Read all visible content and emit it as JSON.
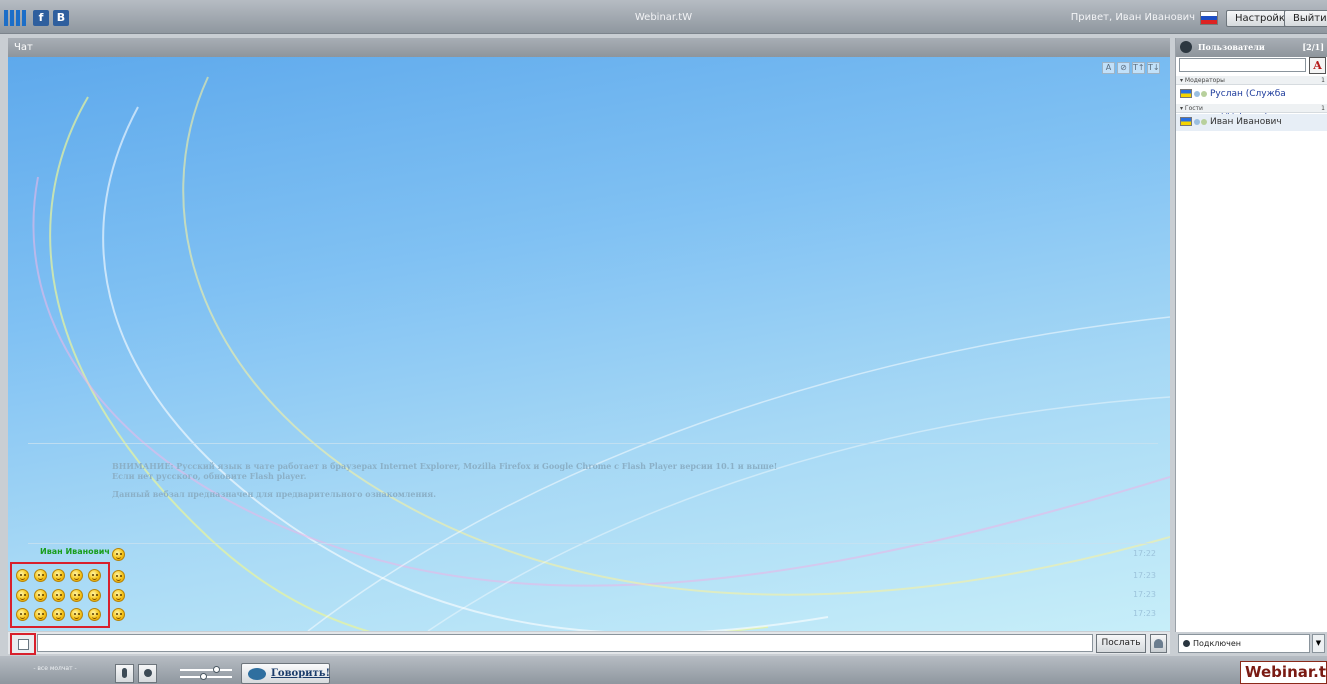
{
  "header": {
    "title": "Webinar.tW",
    "greeting": "Привет, Иван Иванович",
    "social": [
      {
        "label": "f"
      },
      {
        "label": "B"
      }
    ],
    "settings_label": "Настройки",
    "logout_label": "Выйти"
  },
  "chat": {
    "title": "Чат",
    "tools": [
      "A",
      "⊘",
      "T↑",
      "T↓"
    ],
    "notice": {
      "line1": "ВНИМАНИЕ: Русский язык в чате работает в браузерах Internet Explorer, Mozilla Firefox и Google Chrome с Flash Player версии 10.1 и выше!",
      "line2": "Если нет русского, обновите Flash player.",
      "line3": "Данный вебзал предназначен для предварительного ознакомления."
    },
    "messages": [
      {
        "author": "Иван Иванович",
        "time": "17:22"
      },
      {
        "author": "",
        "time": "17:23"
      },
      {
        "author": "",
        "time": "17:23"
      },
      {
        "author": "",
        "time": "17:23"
      }
    ],
    "send_label": "Послать",
    "input_value": ""
  },
  "users": {
    "title": "Пользователи",
    "count": "[2/1]",
    "font_button": "A",
    "groups": [
      {
        "label": "▾ Модераторы",
        "count": "1",
        "users": [
          "Руслан (Служба поддержки)"
        ]
      },
      {
        "label": "▾ Гости",
        "count": "1",
        "users": [
          "Иван Иванович"
        ]
      }
    ],
    "status": "Подключен"
  },
  "bottom": {
    "all_silent": "- все молчат -",
    "talk_label": "Говорить!",
    "brand": "Webinar.tW"
  },
  "colors": {
    "author_green": "#189e1c",
    "user_blue": "#1e3c9c",
    "highlight_red": "#d8202c"
  }
}
